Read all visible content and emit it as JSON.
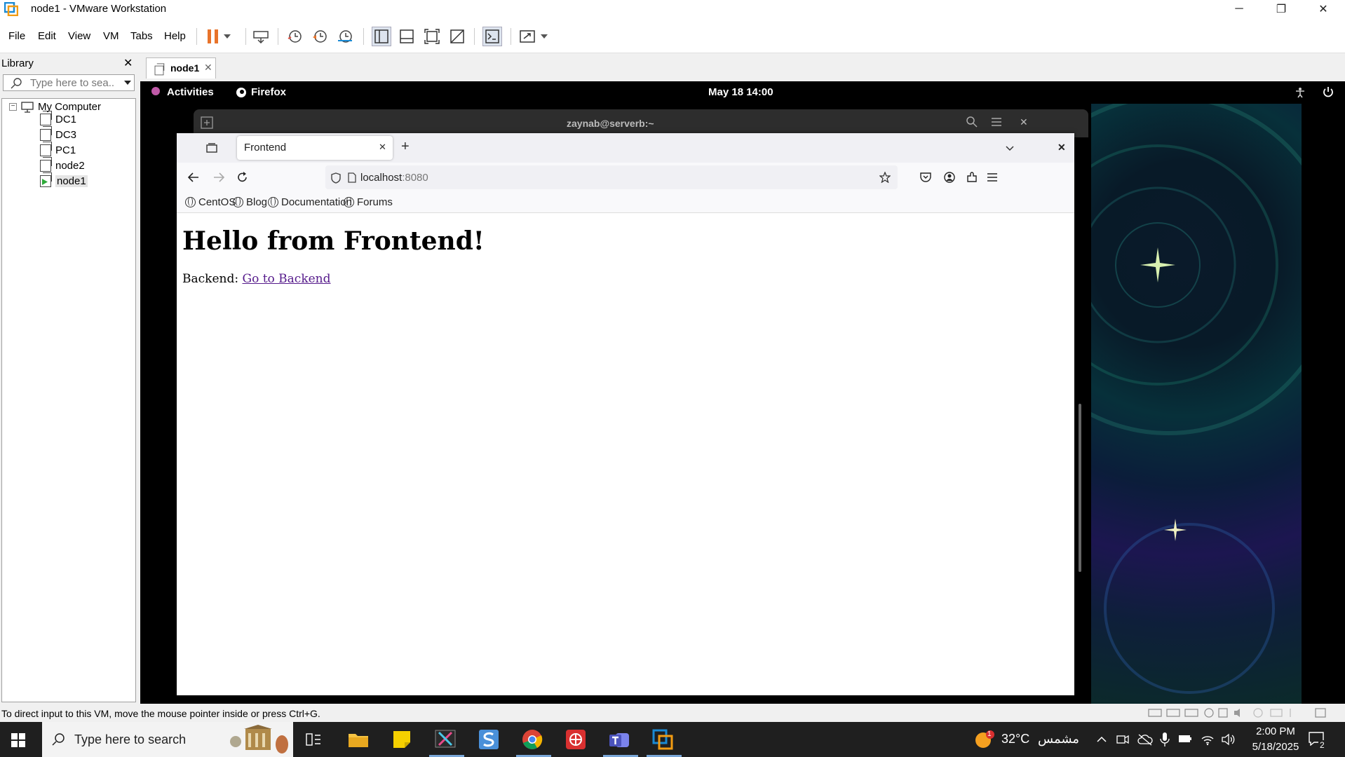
{
  "window": {
    "title": "node1 - VMware Workstation",
    "minimize": "─",
    "restore": "❐",
    "close": "✕"
  },
  "menu": [
    "File",
    "Edit",
    "View",
    "VM",
    "Tabs",
    "Help"
  ],
  "library": {
    "header": "Library",
    "close": "✕",
    "search_placeholder": "Type here to sea...",
    "root": "My Computer",
    "vms": [
      "DC1",
      "DC3",
      "PC1",
      "node2",
      "node1"
    ]
  },
  "vm_tab": {
    "label": "node1",
    "close": "✕"
  },
  "gnome": {
    "activities": "Activities",
    "app": "Firefox",
    "datetime": "May 18  14:00"
  },
  "terminal": {
    "title": "zaynab@serverb:~",
    "close": "✕"
  },
  "firefox": {
    "tab_title": "Frontend",
    "tab_close": "✕",
    "new_tab": "+",
    "url_host": "localhost",
    "url_port": ":8080",
    "bookmarks": [
      "CentOS",
      "Blog",
      "Documentation",
      "Forums"
    ],
    "window_close": "✕"
  },
  "page": {
    "heading": "Hello from Frontend!",
    "backend_label": "Backend: ",
    "backend_link": "Go to Backend"
  },
  "status": {
    "text": "To direct input to this VM, move the mouse pointer inside or press Ctrl+G."
  },
  "taskbar": {
    "search_placeholder": "Type here to search",
    "weather_temp": "32°C",
    "weather_text": "مشمس",
    "weather_badge": "1",
    "time": "2:00 PM",
    "date": "5/18/2025",
    "notifications": "2"
  },
  "colors": {
    "vmware_pause": "#e8732a",
    "link_visited": "#551a8b",
    "taskbar": "#1f1f1f"
  }
}
